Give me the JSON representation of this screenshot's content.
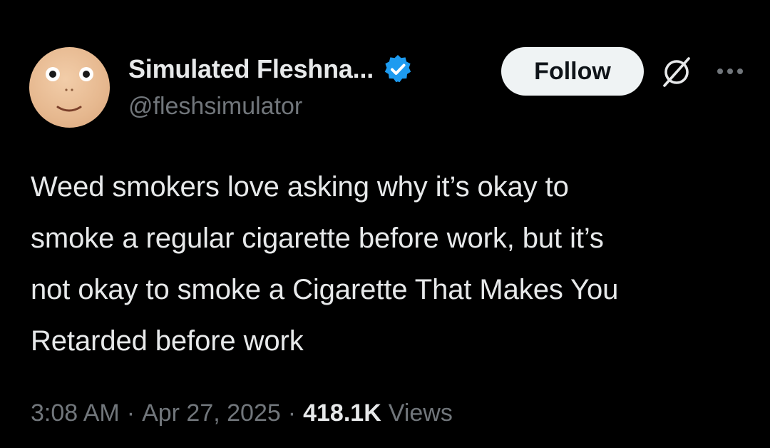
{
  "author": {
    "display_name": "Simulated Fleshna...",
    "handle": "@fleshsimulator",
    "verified": true
  },
  "actions": {
    "follow_label": "Follow",
    "grok_icon": "grok-icon",
    "more_icon": "more-options-icon"
  },
  "tweet": {
    "text": "Weed smokers love asking why it’s okay to\nsmoke a regular cigarette before work, but it’s\nnot okay to smoke a Cigarette That Makes You\nRetarded before work"
  },
  "meta": {
    "time": "3:08 AM",
    "separator": "·",
    "date": "Apr 27, 2025",
    "views_count": "418.1K",
    "views_label": "Views"
  },
  "colors": {
    "background": "#000000",
    "text_primary": "#e7e9ea",
    "text_secondary": "#71767b",
    "verified_blue": "#1d9bf0",
    "follow_bg": "#eff3f4"
  }
}
